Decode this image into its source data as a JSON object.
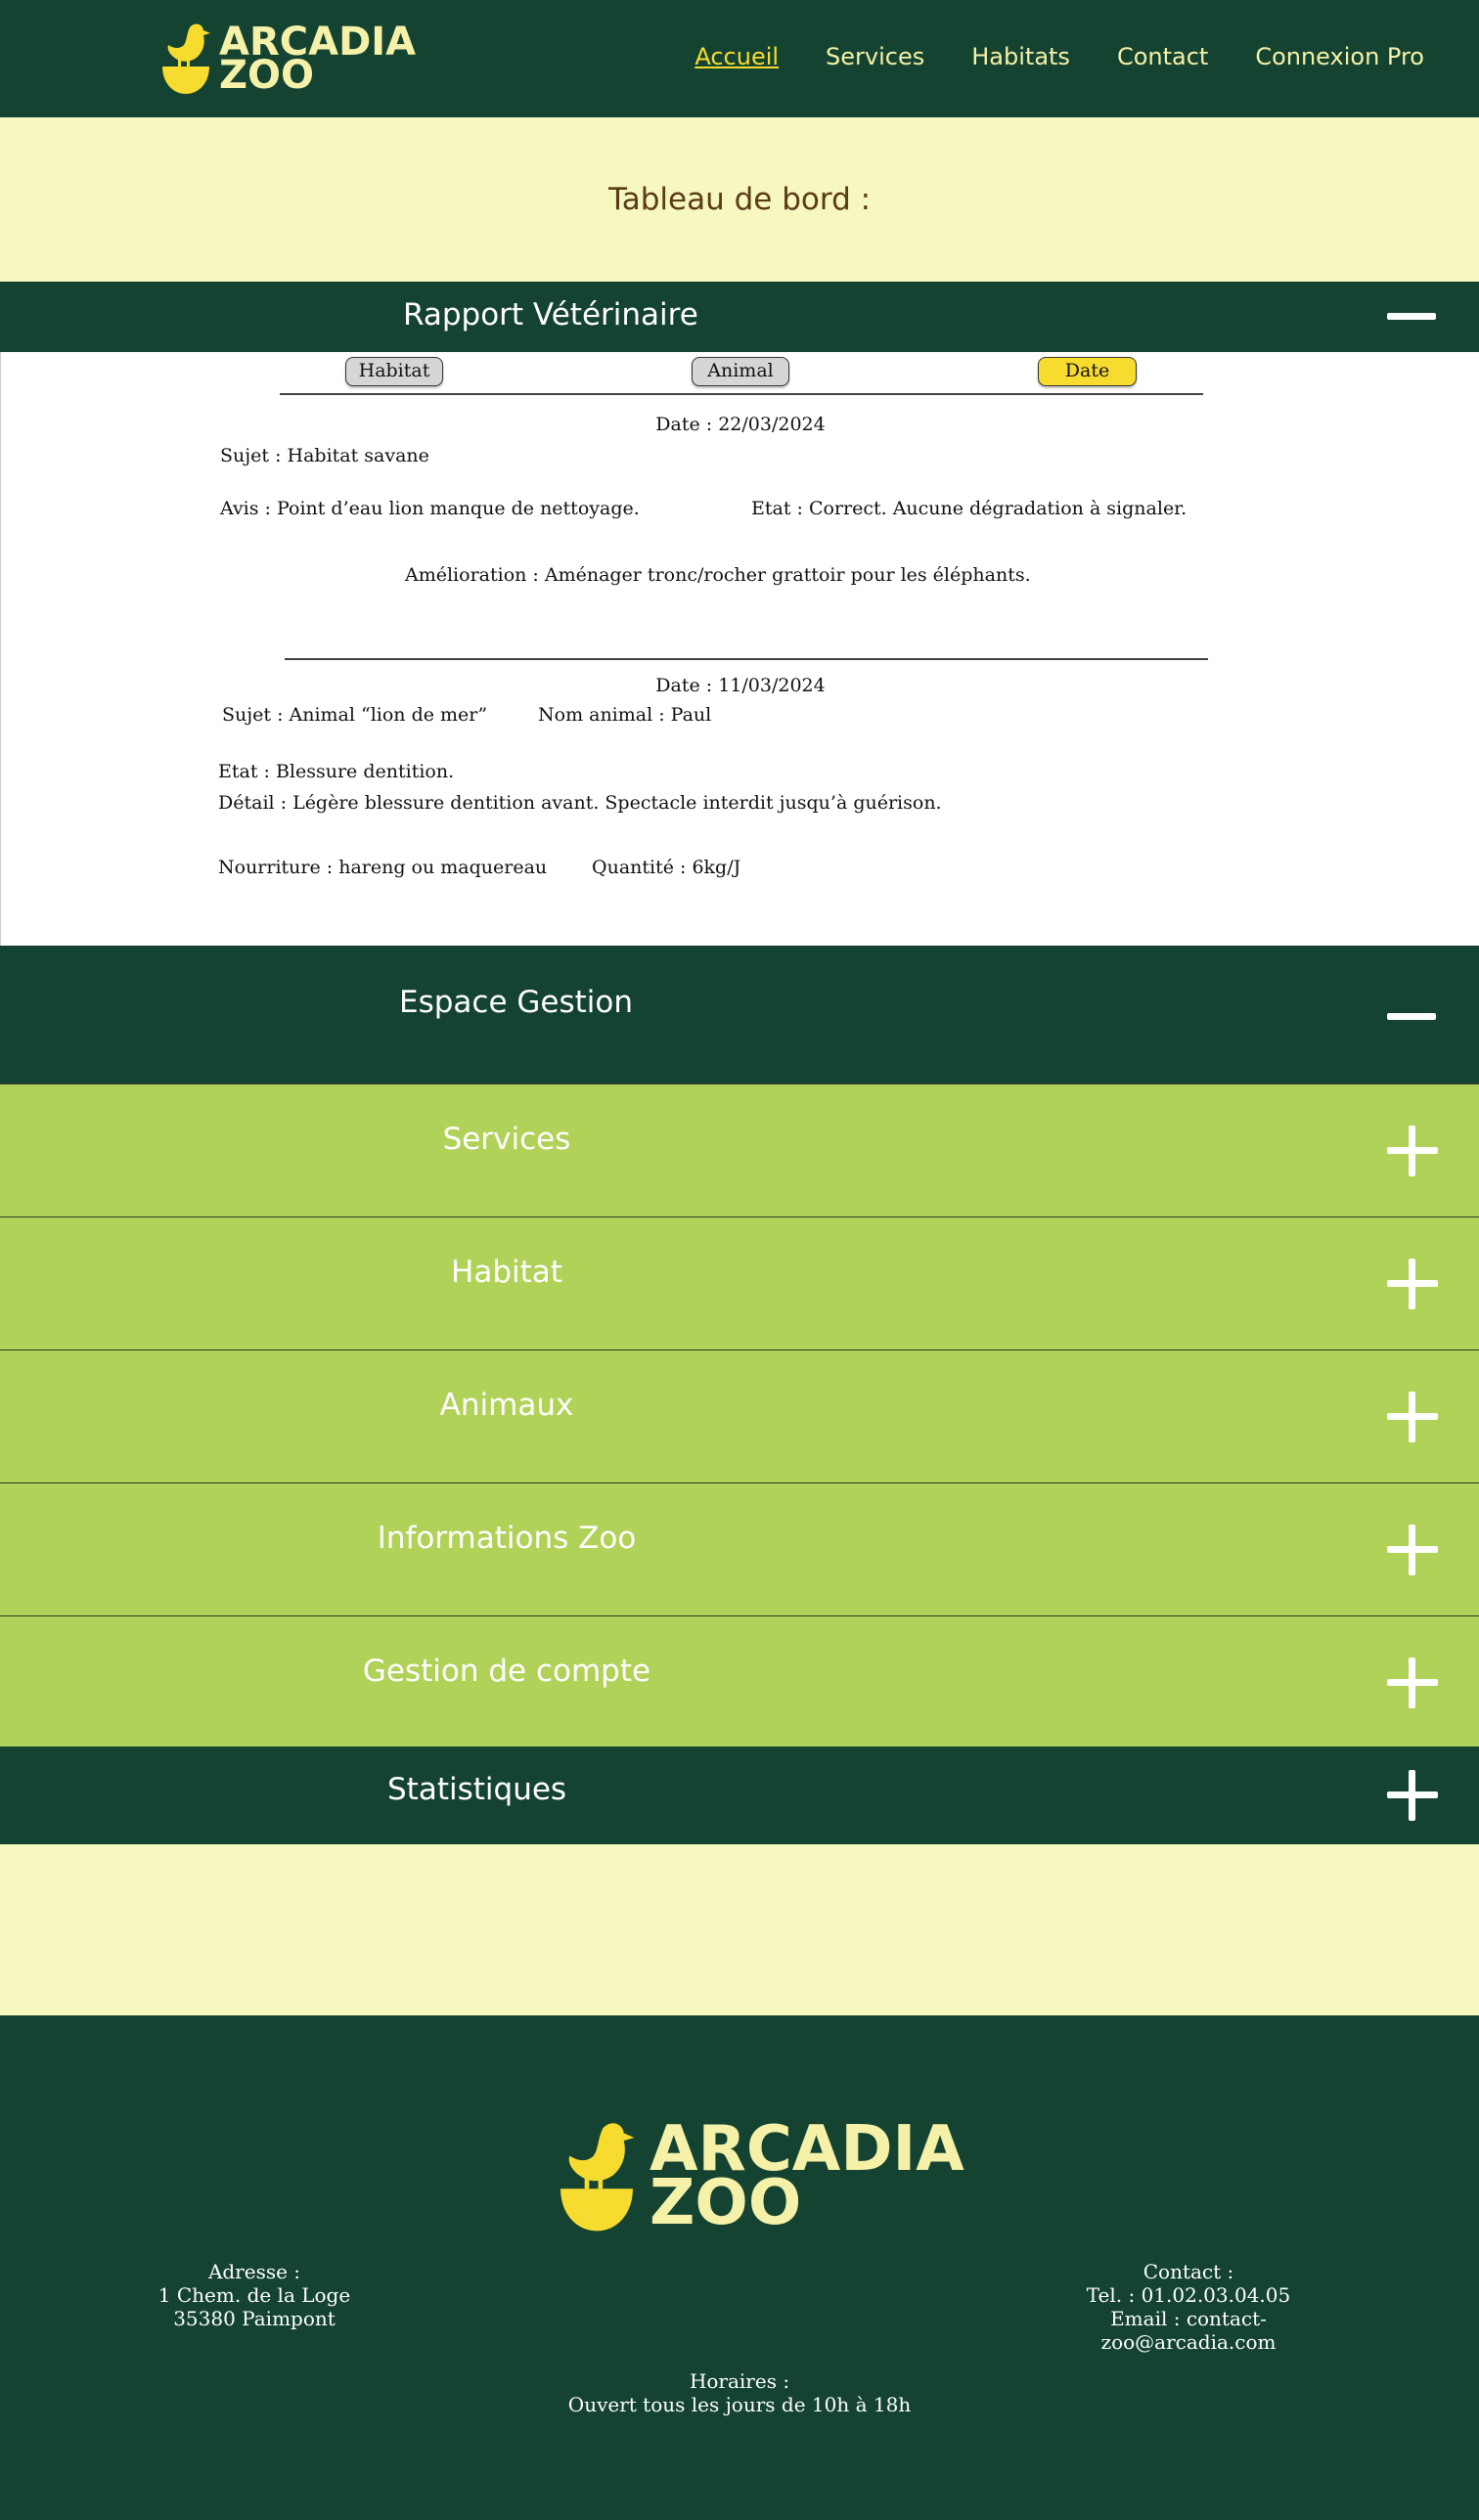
{
  "brand": {
    "line1": "ARCADIA",
    "line2": "ZOO"
  },
  "nav": [
    "Accueil",
    "Services",
    "Habitats",
    "Contact",
    "Connexion Pro"
  ],
  "page_title": "Tableau de bord :",
  "vet": {
    "title": "Rapport Vétérinaire",
    "filters": {
      "habitat": "Habitat",
      "animal": "Animal",
      "date": "Date"
    },
    "reports": [
      {
        "date": "Date : 22/03/2024",
        "sujet": "Sujet : Habitat  savane",
        "avis": "Avis : Point d’eau lion manque de nettoyage.",
        "etat": "Etat : Correct. Aucune dégradation à signaler.",
        "amelioration": "Amélioration : Aménager tronc/rocher grattoir pour les éléphants."
      },
      {
        "date": "Date : 11/03/2024",
        "sujet": "Sujet : Animal  “lion de mer”",
        "nom": "Nom animal : Paul",
        "etat": "Etat : Blessure dentition.",
        "detail": "Détail : Légère blessure dentition avant. Spectacle interdit jusqu’à guérison.",
        "nourriture": "Nourriture : hareng ou maquereau",
        "quantite": "Quantité : 6kg/J"
      }
    ]
  },
  "gestion": {
    "title": "Espace Gestion",
    "items": [
      "Services",
      "Habitat",
      "Animaux",
      "Informations Zoo",
      "Gestion de compte"
    ]
  },
  "stats": {
    "title": "Statistiques"
  },
  "footer": {
    "adresse": [
      "Adresse :",
      "1 Chem. de la Loge",
      "35380 Paimpont"
    ],
    "contact": [
      "Contact :",
      "Tel. : 01.02.03.04.05",
      "Email : contact-",
      "zoo@arcadia.com"
    ],
    "horaires": [
      "Horaires :",
      "Ouvert tous  les jours de 10h à 18h"
    ]
  },
  "colors": {
    "dark_green": "#144331",
    "light_green": "#b1d258",
    "cream": "#f6f8c0",
    "yellow": "#f7dc2f",
    "brown": "#5b3a17"
  },
  "icons": [
    "bird-logo-icon",
    "minus-icon",
    "plus-icon"
  ]
}
